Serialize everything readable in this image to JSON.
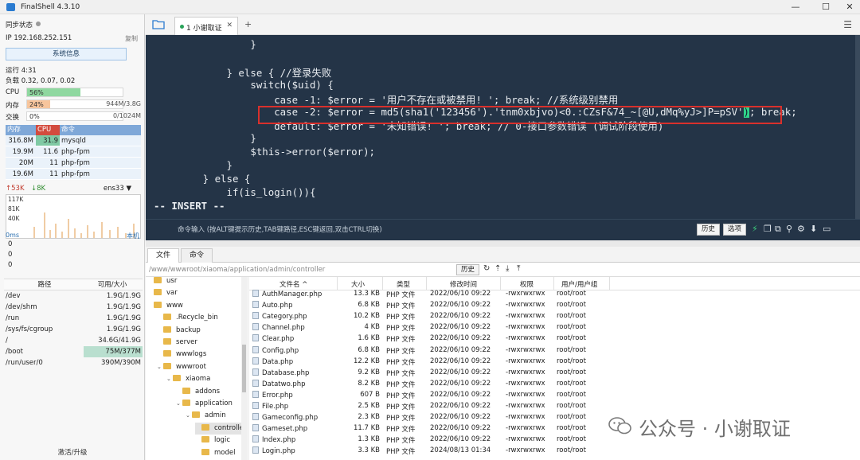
{
  "window": {
    "title": "FinalShell 4.3.10",
    "minimize": "—",
    "maximize": "☐",
    "close": "✕"
  },
  "left": {
    "sync_label": "同步状态",
    "ip": "IP  192.168.252.151",
    "copy": "复制",
    "sysinfo_button": "系统信息",
    "uptime": "运行 4:31",
    "load": "负载 0.32, 0.07, 0.02",
    "cpu": {
      "label": "CPU",
      "pct": "56%",
      "fill": 0.56,
      "color": "#8fd8a0"
    },
    "mem": {
      "label": "内存",
      "pct": "24%",
      "fill": 0.24,
      "right": "944M/3.8G",
      "color": "#f7c59c"
    },
    "swap": {
      "label": "交换",
      "pct": "0%",
      "fill": 0.0,
      "right": "0/1024M"
    },
    "proc_headers": [
      "内存",
      "CPU",
      "命令"
    ],
    "processes": [
      {
        "mem": "316.8M",
        "cpu": "31.9",
        "cmd": "mysqld"
      },
      {
        "mem": "19.9M",
        "cpu": "11.6",
        "cmd": "php-fpm"
      },
      {
        "mem": "20M",
        "cpu": "11",
        "cmd": "php-fpm"
      },
      {
        "mem": "19.6M",
        "cpu": "11",
        "cmd": "php-fpm"
      }
    ],
    "net": {
      "up": "↑53K",
      "down": "↓8K",
      "iface": "ens33 ▼",
      "ticks": [
        "117K",
        "81K",
        "40K"
      ]
    },
    "ping": {
      "label": "0ms",
      "host": "本机",
      "values": [
        "0",
        "0",
        "0"
      ]
    },
    "disk_headers": [
      "路径",
      "可用/大小"
    ],
    "disks": [
      {
        "path": "/dev",
        "size": "1.9G/1.9G"
      },
      {
        "path": "/dev/shm",
        "size": "1.9G/1.9G"
      },
      {
        "path": "/run",
        "size": "1.9G/1.9G"
      },
      {
        "path": "/sys/fs/cgroup",
        "size": "1.9G/1.9G"
      },
      {
        "path": "/",
        "size": "34.6G/41.9G"
      },
      {
        "path": "/boot",
        "size": "75M/377M"
      },
      {
        "path": "/run/user/0",
        "size": "390M/390M"
      }
    ],
    "upgrade": "激活/升级"
  },
  "tabs": {
    "session": "1 小谢取证",
    "close": "✕",
    "add": "+",
    "menu": "☰"
  },
  "terminal": {
    "lines": [
      "                }",
      "",
      "            } else { //登录失败",
      "                switch($uid) {",
      "                    case -1: $error = '用户不存在或被禁用! '; break; //系统级别禁用",
      "                    case -2: $error = md5(sha1('123456').'tnm0xbjvo)<0.:CZsF&74_~[@U,dMq%yJ>]P=pSV'",
      "                    default: $error = '未知错误! '; break; // 0-接口参数错误 (调试阶段使用)",
      "                }",
      "                $this->error($error);",
      "            }",
      "        } else {",
      "            if(is_login()){",
      "-- INSERT --"
    ],
    "cursor_char": ")",
    "after_cursor": "; break;",
    "cmd_hint": "命令输入 (按ALT键提示历史,TAB键路径,ESC键返回,双击CTRL切换)",
    "history_button": "历史",
    "options_button": "选项"
  },
  "filebrowser": {
    "tabs": [
      "文件",
      "命令"
    ],
    "path": "/www/wwwroot/xiaoma/application/admin/controller",
    "history_button": "历史",
    "tree": [
      {
        "label": "usr",
        "indent": 0,
        "arrow": ""
      },
      {
        "label": "var",
        "indent": 0,
        "arrow": ""
      },
      {
        "label": "www",
        "indent": 0,
        "arrow": ""
      },
      {
        "label": ".Recycle_bin",
        "indent": 1,
        "arrow": ""
      },
      {
        "label": "backup",
        "indent": 1,
        "arrow": ""
      },
      {
        "label": "server",
        "indent": 1,
        "arrow": ""
      },
      {
        "label": "wwwlogs",
        "indent": 1,
        "arrow": ""
      },
      {
        "label": "wwwroot",
        "indent": 1,
        "arrow": "⌄"
      },
      {
        "label": "xiaoma",
        "indent": 2,
        "arrow": "⌄"
      },
      {
        "label": "addons",
        "indent": 3,
        "arrow": ""
      },
      {
        "label": "application",
        "indent": 3,
        "arrow": "⌄"
      },
      {
        "label": "admin",
        "indent": 4,
        "arrow": "⌄"
      },
      {
        "label": "controller",
        "indent": 5,
        "arrow": ""
      },
      {
        "label": "logic",
        "indent": 5,
        "arrow": ""
      },
      {
        "label": "model",
        "indent": 5,
        "arrow": ""
      }
    ],
    "columns": [
      "文件名 ^",
      "大小",
      "类型",
      "修改时间",
      "权限",
      "用户/用户组"
    ],
    "files": [
      {
        "name": "AuthManager.php",
        "size": "13.3 KB",
        "type": "PHP 文件",
        "time": "2022/06/10 09:22",
        "perm": "-rwxrwxrwx",
        "owner": "root/root"
      },
      {
        "name": "Auto.php",
        "size": "6.8 KB",
        "type": "PHP 文件",
        "time": "2022/06/10 09:22",
        "perm": "-rwxrwxrwx",
        "owner": "root/root"
      },
      {
        "name": "Category.php",
        "size": "10.2 KB",
        "type": "PHP 文件",
        "time": "2022/06/10 09:22",
        "perm": "-rwxrwxrwx",
        "owner": "root/root"
      },
      {
        "name": "Channel.php",
        "size": "4 KB",
        "type": "PHP 文件",
        "time": "2022/06/10 09:22",
        "perm": "-rwxrwxrwx",
        "owner": "root/root"
      },
      {
        "name": "Clear.php",
        "size": "1.6 KB",
        "type": "PHP 文件",
        "time": "2022/06/10 09:22",
        "perm": "-rwxrwxrwx",
        "owner": "root/root"
      },
      {
        "name": "Config.php",
        "size": "6.8 KB",
        "type": "PHP 文件",
        "time": "2022/06/10 09:22",
        "perm": "-rwxrwxrwx",
        "owner": "root/root"
      },
      {
        "name": "Data.php",
        "size": "12.2 KB",
        "type": "PHP 文件",
        "time": "2022/06/10 09:22",
        "perm": "-rwxrwxrwx",
        "owner": "root/root"
      },
      {
        "name": "Database.php",
        "size": "9.2 KB",
        "type": "PHP 文件",
        "time": "2022/06/10 09:22",
        "perm": "-rwxrwxrwx",
        "owner": "root/root"
      },
      {
        "name": "Datatwo.php",
        "size": "8.2 KB",
        "type": "PHP 文件",
        "time": "2022/06/10 09:22",
        "perm": "-rwxrwxrwx",
        "owner": "root/root"
      },
      {
        "name": "Error.php",
        "size": "607 B",
        "type": "PHP 文件",
        "time": "2022/06/10 09:22",
        "perm": "-rwxrwxrwx",
        "owner": "root/root"
      },
      {
        "name": "File.php",
        "size": "2.5 KB",
        "type": "PHP 文件",
        "time": "2022/06/10 09:22",
        "perm": "-rwxrwxrwx",
        "owner": "root/root"
      },
      {
        "name": "Gameconfig.php",
        "size": "2.3 KB",
        "type": "PHP 文件",
        "time": "2022/06/10 09:22",
        "perm": "-rwxrwxrwx",
        "owner": "root/root"
      },
      {
        "name": "Gameset.php",
        "size": "11.7 KB",
        "type": "PHP 文件",
        "time": "2022/06/10 09:22",
        "perm": "-rwxrwxrwx",
        "owner": "root/root"
      },
      {
        "name": "Index.php",
        "size": "1.3 KB",
        "type": "PHP 文件",
        "time": "2022/06/10 09:22",
        "perm": "-rwxrwxrwx",
        "owner": "root/root"
      },
      {
        "name": "Login.php",
        "size": "3.3 KB",
        "type": "PHP 文件",
        "time": "2024/08/13 01:34",
        "perm": "-rwxrwxrwx",
        "owner": "root/root"
      }
    ]
  },
  "watermark": {
    "text": "公众号 · 小谢取证"
  }
}
